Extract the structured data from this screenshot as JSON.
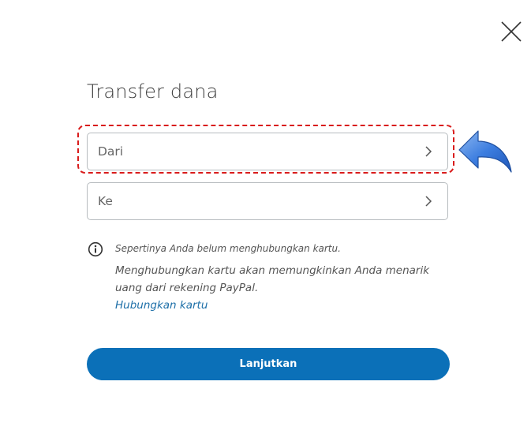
{
  "dialog": {
    "title": "Transfer dana"
  },
  "fields": {
    "from_label": "Dari",
    "to_label": "Ke"
  },
  "notice": {
    "line1": "Sepertinya Anda belum menghubungkan kartu.",
    "line2": "Menghubungkan kartu akan memungkinkan Anda menarik uang dari rekening PayPal.",
    "link": "Hubungkan kartu"
  },
  "actions": {
    "continue_label": "Lanjutkan"
  },
  "colors": {
    "primary_button": "#0b70b8",
    "link": "#1d6fa8",
    "highlight_dash": "#d91c1c",
    "annotation_arrow": "#2f6fd6"
  },
  "icons": {
    "close": "close-icon",
    "chevron": "chevron-right-icon",
    "info": "info-icon",
    "annotation": "curved-arrow-icon"
  }
}
